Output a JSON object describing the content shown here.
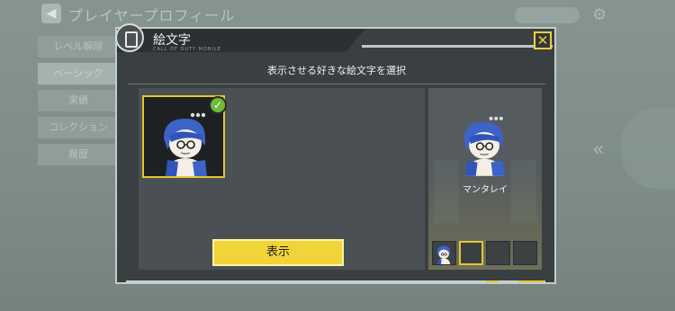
{
  "background": {
    "title": "プレイヤープロフィール",
    "nav": [
      "レベル解除",
      "ベーシック",
      "実績",
      "コレクション",
      "履歴"
    ]
  },
  "modal": {
    "title": "絵文字",
    "brand": "CALL OF DUTY MOBILE",
    "instruction": "表示させる好きな絵文字を選択",
    "show_button": "表示",
    "close_label": "✕",
    "preview_name": "マンタレイ",
    "slots_count": 4,
    "selected_check": "✓"
  },
  "colors": {
    "accent": "#f0d43a",
    "check": "#6dbd3a",
    "panel": "#3a3f42"
  }
}
